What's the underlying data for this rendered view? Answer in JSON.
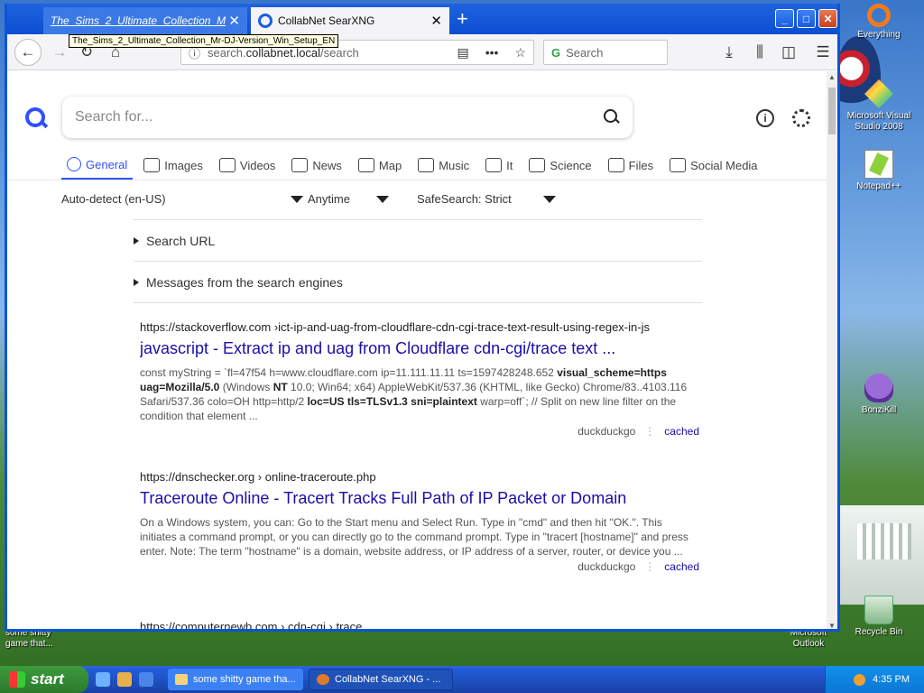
{
  "desktop": {
    "icons": [
      {
        "label": "Everything",
        "icon": "everything-icon"
      },
      {
        "label": "Microsoft Visual Studio 2008",
        "icon": "visual-studio-icon"
      },
      {
        "label": "Notepad++",
        "icon": "notepad-plus-plus-icon"
      },
      {
        "label": "BonziKill",
        "icon": "bonzi-icon"
      },
      {
        "label": "Recycle Bin",
        "icon": "recycle-bin-icon"
      }
    ],
    "partial_left_label": "some shitty game that...",
    "partial_right_label": "Microsoft Outlook"
  },
  "browser": {
    "tabs": [
      {
        "title": "The_Sims_2_Ultimate_Collection_M",
        "close": "✕"
      },
      {
        "title": "CollabNet SearXNG",
        "close": "✕"
      }
    ],
    "tooltip": "The_Sims_2_Ultimate_Collection_Mr-DJ-Version_Win_Setup_EN",
    "new_tab": "+",
    "url": {
      "prefix": "search.",
      "host": "collabnet.local",
      "path": "/search"
    },
    "search_placeholder": "Search"
  },
  "searxng": {
    "search_placeholder": "Search for...",
    "categories": [
      {
        "label": "General",
        "icon": "search-icon",
        "active": true
      },
      {
        "label": "Images",
        "icon": "image-icon"
      },
      {
        "label": "Videos",
        "icon": "play-icon"
      },
      {
        "label": "News",
        "icon": "newspaper-icon"
      },
      {
        "label": "Map",
        "icon": "map-pin-icon"
      },
      {
        "label": "Music",
        "icon": "music-icon"
      },
      {
        "label": "It",
        "icon": "layers-icon"
      },
      {
        "label": "Science",
        "icon": "science-icon"
      },
      {
        "label": "Files",
        "icon": "files-icon"
      },
      {
        "label": "Social Media",
        "icon": "people-icon"
      }
    ],
    "filters": {
      "language": "Auto-detect (en-US)",
      "time": "Anytime",
      "safesearch": "SafeSearch: Strict"
    },
    "details": {
      "search_url": "Search URL",
      "messages": "Messages from the search engines"
    },
    "results": [
      {
        "url": "https://stackoverflow.com  ›ict-ip-and-uag-from-cloudflare-cdn-cgi-trace-text-result-using-regex-in-js",
        "title": "javascript - Extract ip and uag from Cloudflare cdn-cgi/trace text ...",
        "content_1": "const myString = `fl=47f54 h=www.cloudflare.com ip=11.111.11.11 ts=1597428248.652 ",
        "content_2": "visual_scheme=https uag=Mozilla/5.0",
        "content_3": " (Windows ",
        "content_4": "NT",
        "content_5": " 10.0; Win64; x64) AppleWebKit/537.36 (KHTML, like Gecko) Chrome/83..4103.116 Safari/537.36 colo=OH http=http/2 ",
        "content_6": "loc=US tls=TLSv1.3 sni=plaintext",
        "content_7": " warp=off`; // Split on new line filter on the condition that element ...",
        "engine": "duckduckgo",
        "cached": "cached"
      },
      {
        "url": "https://dnschecker.org  › online-traceroute.php",
        "title": "Traceroute Online - Tracert Tracks Full Path of IP Packet or Domain",
        "content": "On a Windows system, you can: Go to the Start menu and Select Run. Type in \"cmd\" and then hit \"OK.\". This initiates a command prompt, or you can directly go to the command prompt. Type in \"tracert [hostname]\" and press enter. Note: The term \"hostname\" is a domain, website address, or IP address of a server, router, or device you ...",
        "engine": "duckduckgo",
        "cached": "cached"
      },
      {
        "url": "https://computernewb.com  › cdn-cgi › trace"
      }
    ]
  },
  "taskbar": {
    "start": "start",
    "tasks": [
      {
        "label": "some shitty game tha..."
      },
      {
        "label": "CollabNet SearXNG - ..."
      }
    ],
    "clock": "4:35 PM"
  }
}
